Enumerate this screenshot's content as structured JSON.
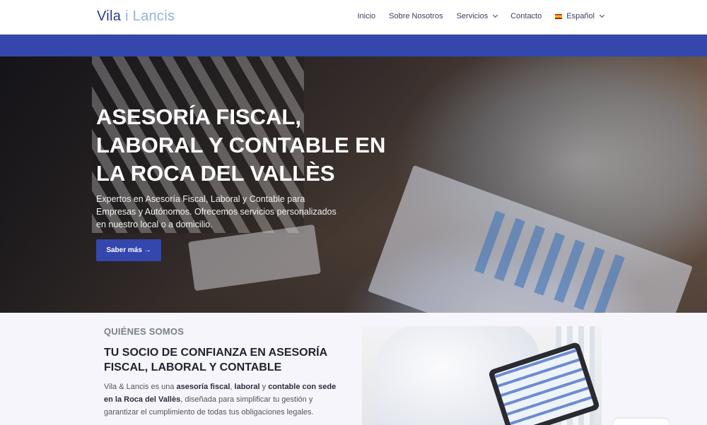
{
  "header": {
    "logo_part1": "Vila",
    "logo_part2": "i Lancis",
    "nav": [
      {
        "label": "Inicio"
      },
      {
        "label": "Sobre Nosotros"
      },
      {
        "label": "Servicios"
      },
      {
        "label": "Contacto"
      },
      {
        "label": "Español"
      }
    ]
  },
  "hero": {
    "title": "ASESORÍA FISCAL, LABORAL Y CONTABLE EN LA ROCA DEL VALLÈS",
    "text": "Expertos en Asesoría Fiscal, Laboral y Contable para Empresas y Autónomos. Ofrecemos servicios personalizados en nuestro local o a domicilio.",
    "button": "Saber más →"
  },
  "about": {
    "eyebrow": "QUIÉNES SOMOS",
    "title": "TU SOCIO DE CONFIANZA EN ASESORÍA FISCAL, LABORAL Y CONTABLE",
    "text_1": "Vila & Lancis es una",
    "bold_1": "asesoría fiscal",
    "text_2": ",",
    "bold_2": "laboral",
    "text_3": "y",
    "bold_3": "contable con sede en la Roca del Vallès",
    "text_4": ", diseñada para simplificar tu gestión y garantizar el cumplimiento de todas tus obligaciones legales."
  },
  "colors": {
    "brand_blue": "#3347ad",
    "logo_dark": "#2b3a8f",
    "logo_light": "#8db4dc"
  }
}
